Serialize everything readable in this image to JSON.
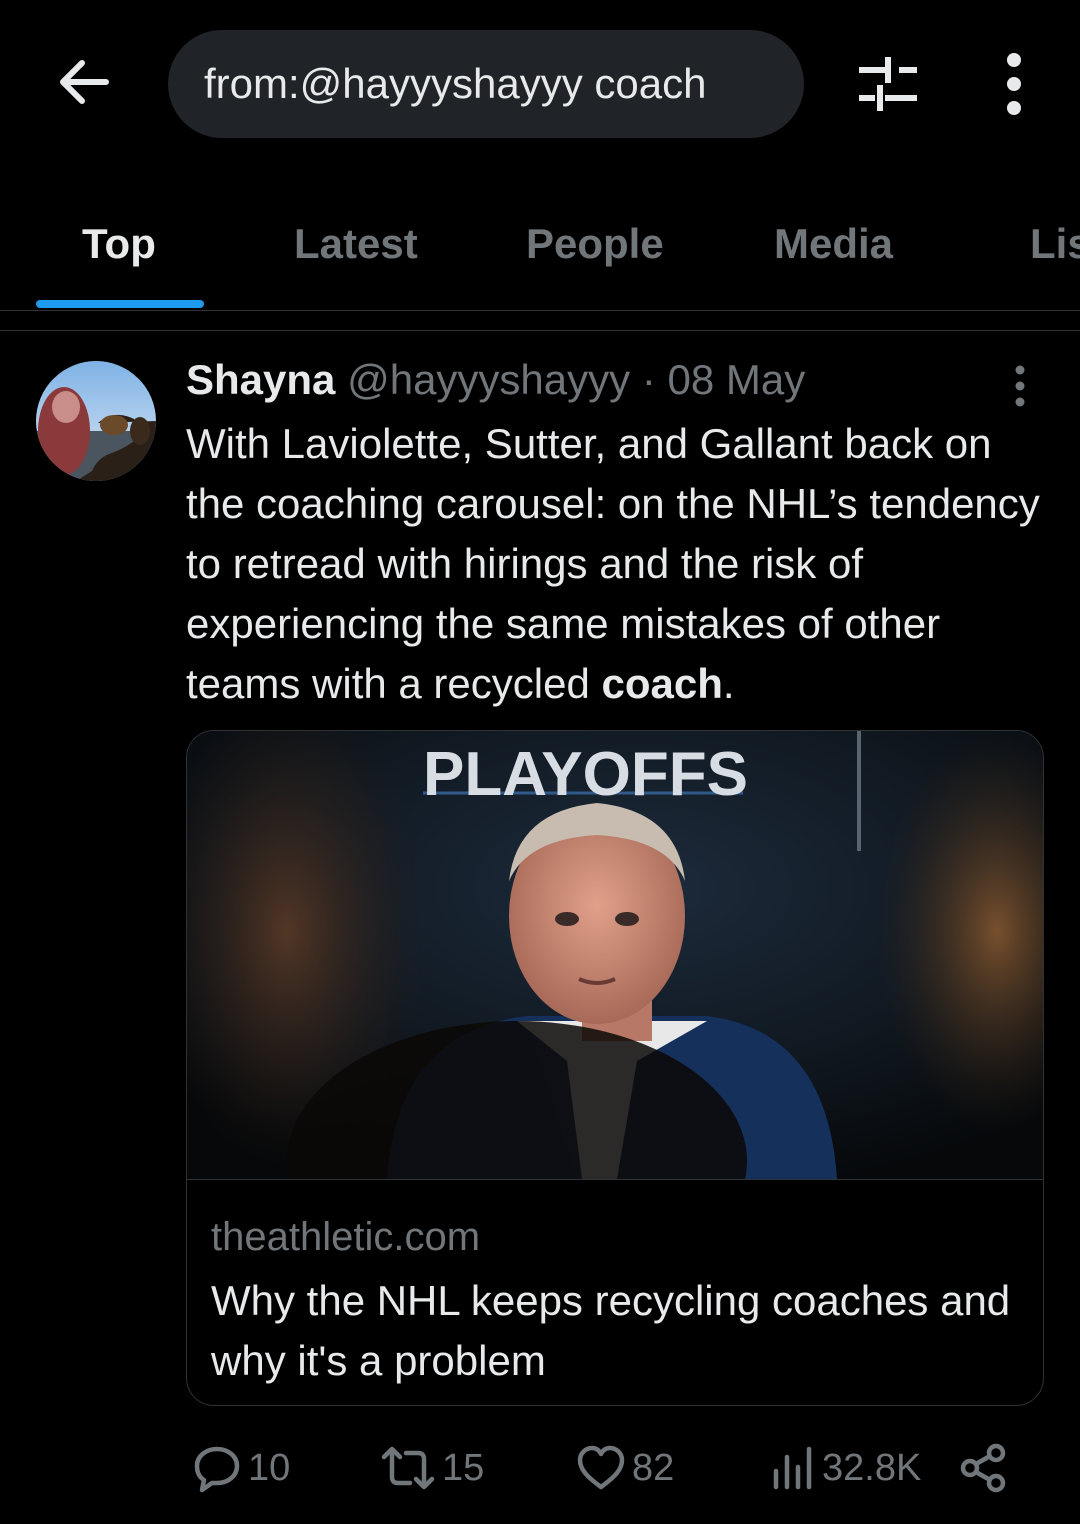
{
  "header": {
    "back_icon": "arrow-left-icon",
    "search_value": "from:@hayyyshayyy coach",
    "filter_icon": "sliders-icon",
    "more_icon": "more-vertical-icon"
  },
  "tabs": [
    {
      "label": "Top",
      "active": true
    },
    {
      "label": "Latest",
      "active": false
    },
    {
      "label": "People",
      "active": false
    },
    {
      "label": "Media",
      "active": false
    },
    {
      "label": "Lis",
      "active": false
    }
  ],
  "tweet": {
    "name": "Shayna",
    "handle": "@hayyyshayyy",
    "separator": "·",
    "date": "08 May",
    "text_before": "With Laviolette, Sutter, and Gallant back on the coaching carousel: on the NHL’s tendency to retread with hirings and the risk of experiencing the same mistakes of other teams with a recycled ",
    "text_bold": "coach",
    "text_after": ".",
    "card": {
      "image_banner": "PLAYOFFS",
      "domain": "theathletic.com",
      "title": "Why the NHL keeps recycling coaches and why it's a problem"
    },
    "actions": {
      "replies": "10",
      "retweets": "15",
      "likes": "82",
      "views": "32.8K"
    }
  },
  "colors": {
    "background": "#000000",
    "text": "#e7e9ea",
    "secondary": "#71767b",
    "accent": "#1d9bf0",
    "border": "#2f3336"
  }
}
